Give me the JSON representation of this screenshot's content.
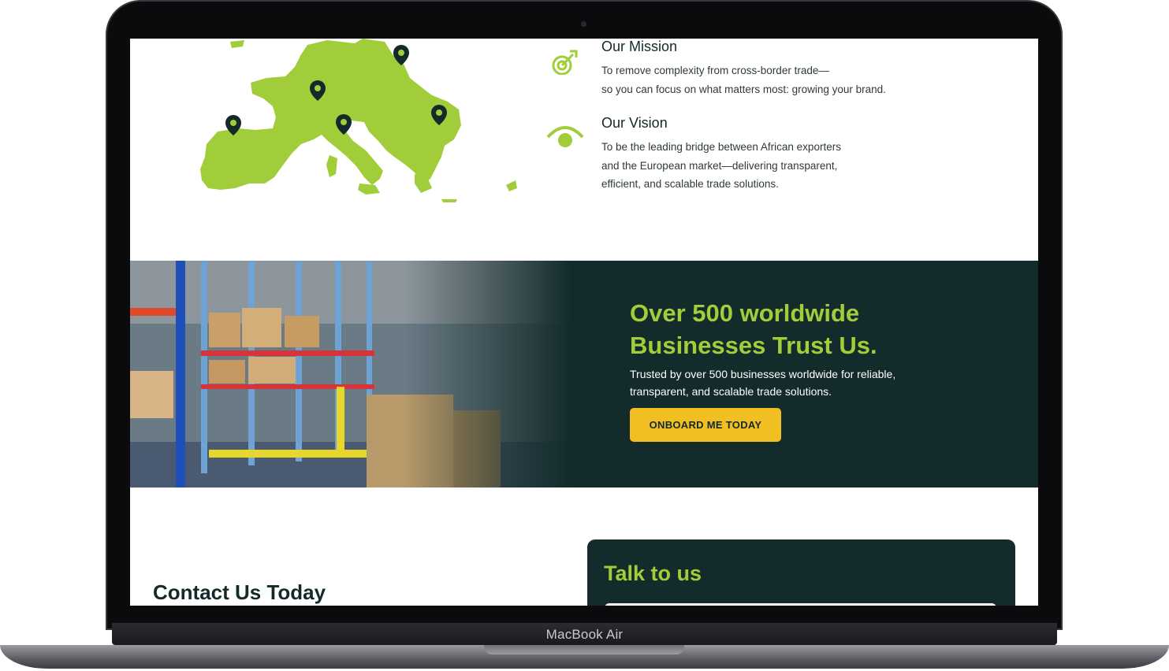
{
  "device": {
    "label": "MacBook Air"
  },
  "mission": {
    "title": "Our Mission",
    "lines": [
      "To remove complexity from cross-border trade—",
      "so you can focus on what matters most: growing your brand."
    ],
    "icon": "target-icon"
  },
  "vision": {
    "title": "Our Vision",
    "lines": [
      "To be the leading bridge between African exporters",
      "and the European market—delivering transparent,",
      "efficient, and scalable trade solutions."
    ],
    "icon": "eye-icon"
  },
  "trust": {
    "title_line1": "Over 500 worldwide",
    "title_line2": "Businesses Trust Us.",
    "subtitle_line1": "Trusted by over 500 businesses worldwide for reliable,",
    "subtitle_line2": "transparent, and scalable trade solutions.",
    "button": "ONBOARD ME TODAY"
  },
  "contact": {
    "heading": "Contact Us Today",
    "card_title": "Talk to us"
  },
  "colors": {
    "brand_green": "#a2cd3a",
    "dark_teal": "#132b2a",
    "button_yellow": "#f2bf22"
  }
}
